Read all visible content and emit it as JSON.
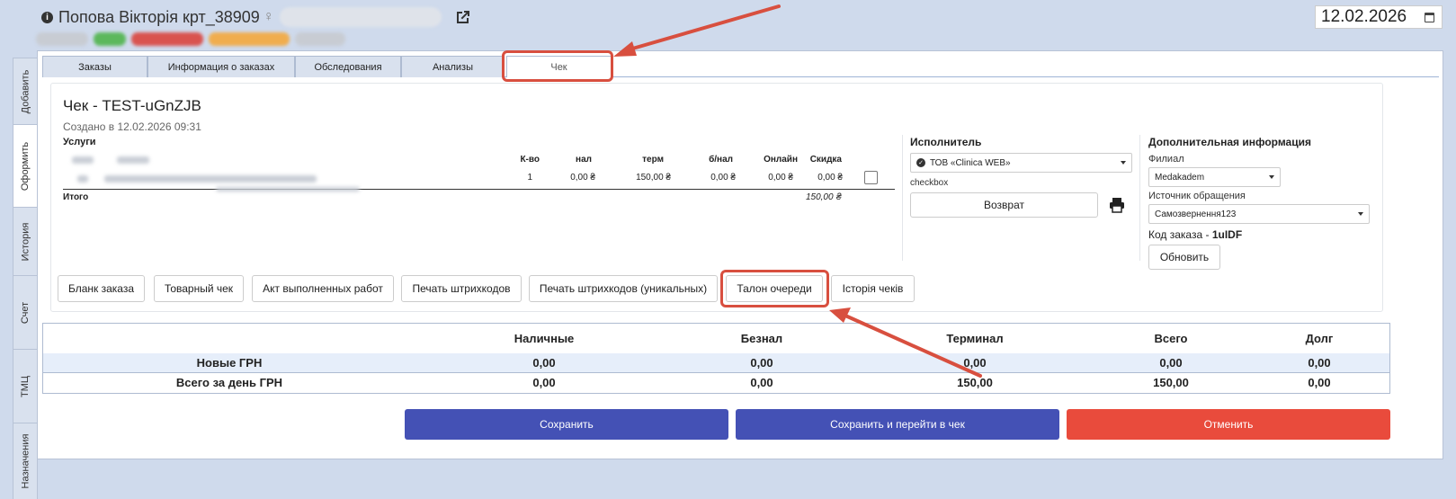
{
  "header": {
    "patient_name": "Попова Вікторія крт_38909",
    "gender_symbol": "♀",
    "date": "12.02.2026"
  },
  "side_tabs": [
    "Добавить",
    "Оформить",
    "История",
    "Счет",
    "ТМЦ",
    "Назначения"
  ],
  "tabs": [
    "Заказы",
    "Информация о заказах",
    "Обследования",
    "Анализы",
    "Чек"
  ],
  "receipt": {
    "title": "Чек - TEST-uGnZJB",
    "created": "Создано в 12.02.2026 09:31",
    "services_label": "Услуги",
    "columns": [
      "К-во",
      "нал",
      "терм",
      "б/нал",
      "Онлайн",
      "Скидка"
    ],
    "row": [
      "1",
      "0,00 ₴",
      "150,00 ₴",
      "0,00 ₴",
      "0,00 ₴",
      "0,00 ₴"
    ],
    "total_label": "Итого",
    "total_value": "150,00 ₴"
  },
  "executor": {
    "heading": "Исполнитель",
    "selected": "ТОВ «Clinica WEB»",
    "checkbox_label": "checkbox",
    "refund_button": "Возврат"
  },
  "additional": {
    "heading": "Дополнительная информация",
    "branch_label": "Филиал",
    "branch_value": "Medakadem",
    "source_label": "Источник обращения",
    "source_value": "Самозвернення123",
    "order_code_label": "Код заказа -",
    "order_code_value": "1uIDF",
    "refresh_button": "Обновить"
  },
  "actions": [
    "Бланк заказа",
    "Товарный чек",
    "Акт выполненных работ",
    "Печать штрихкодов",
    "Печать штрихкодов (уникальных)",
    "Талон очереди",
    "Історія чеків"
  ],
  "summary": {
    "headers": [
      "Наличные",
      "Безнал",
      "Терминал",
      "Всего",
      "Долг"
    ],
    "rows": [
      {
        "label": "Новые ГРН",
        "values": [
          "0,00",
          "0,00",
          "0,00",
          "0,00",
          "0,00"
        ]
      },
      {
        "label": "Всего за день ГРН",
        "values": [
          "0,00",
          "0,00",
          "150,00",
          "150,00",
          "0,00"
        ]
      }
    ]
  },
  "footer": {
    "save": "Сохранить",
    "save_and_go": "Сохранить и перейти в чек",
    "cancel": "Отменить"
  },
  "colors": {
    "primary": "#4451b5",
    "danger": "#e94b3c",
    "annotation": "#d84f3f"
  }
}
